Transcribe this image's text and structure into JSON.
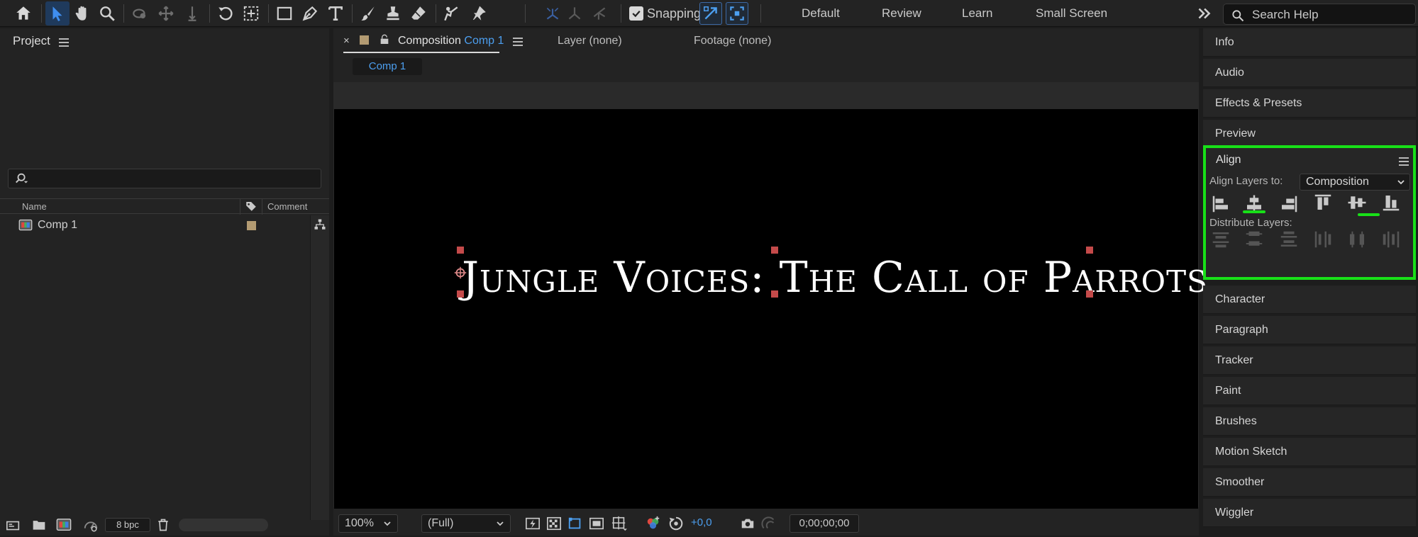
{
  "toolbar": {
    "tools": [
      {
        "name": "home-icon"
      },
      {
        "name": "selection-tool-icon",
        "selected": true
      },
      {
        "name": "hand-tool-icon"
      },
      {
        "name": "zoom-tool-icon"
      },
      {
        "name": "orbit-camera-icon"
      },
      {
        "name": "pan-camera-icon"
      },
      {
        "name": "dolly-camera-icon"
      },
      {
        "name": "rotation-tool-icon"
      },
      {
        "name": "pan-behind-icon"
      },
      {
        "name": "rectangle-tool-icon"
      },
      {
        "name": "pen-tool-icon"
      },
      {
        "name": "type-tool-icon"
      },
      {
        "name": "brush-tool-icon"
      },
      {
        "name": "clone-stamp-icon"
      },
      {
        "name": "eraser-tool-icon"
      },
      {
        "name": "roto-brush-icon"
      },
      {
        "name": "puppet-pin-icon"
      }
    ],
    "snapping_label": "Snapping",
    "snapping_checked": true,
    "workspaces": [
      "Default",
      "Review",
      "Learn",
      "Small Screen"
    ],
    "search_placeholder": "Search Help"
  },
  "project": {
    "title": "Project",
    "columns": {
      "name": "Name",
      "comment": "Comment"
    },
    "items": [
      {
        "name": "Comp 1",
        "label_color": "#b39b72"
      }
    ],
    "bpc": "8 bpc"
  },
  "composition": {
    "tab_prefix": "Composition",
    "tab_comp": "Comp 1",
    "layer_tab": "Layer (none)",
    "footage_tab": "Footage (none)",
    "active_comp": "Comp 1",
    "title_text": "Jungle Voices: The Call of Parrots",
    "zoom": "100%",
    "resolution": "(Full)",
    "exposure": "+0,0",
    "timecode": "0;00;00;00"
  },
  "right_panels": {
    "top": [
      "Info",
      "Audio",
      "Effects & Presets",
      "Preview"
    ],
    "align": {
      "title": "Align",
      "align_to_label": "Align Layers to:",
      "align_to_value": "Composition",
      "distribute_label": "Distribute Layers:"
    },
    "bottom": [
      "Character",
      "Paragraph",
      "Tracker",
      "Paint",
      "Brushes",
      "Motion Sketch",
      "Smoother",
      "Wiggler"
    ]
  },
  "colors": {
    "accent_blue": "#4c9ff0",
    "highlight_green": "#18e018",
    "handle_red": "#c44a4a"
  }
}
